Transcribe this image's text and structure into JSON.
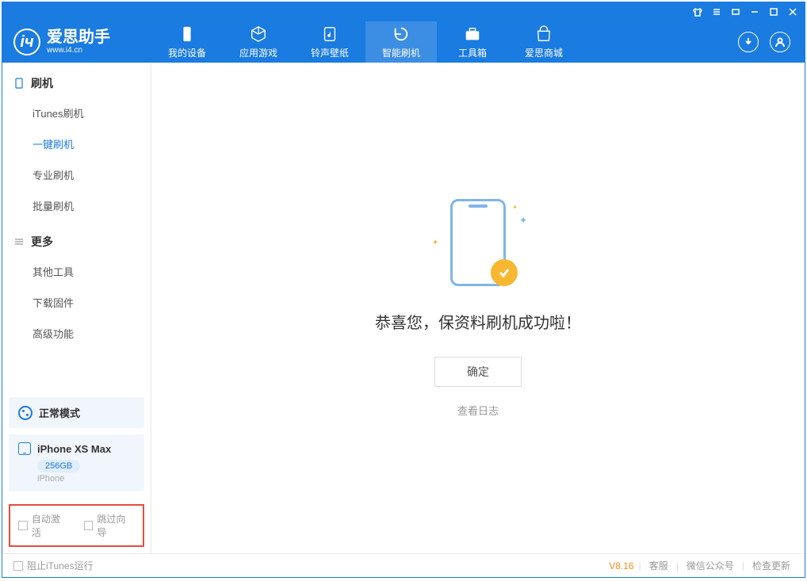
{
  "app": {
    "title": "爱思助手",
    "subtitle": "www.i4.cn"
  },
  "tabs": [
    {
      "label": "我的设备"
    },
    {
      "label": "应用游戏"
    },
    {
      "label": "铃声壁纸"
    },
    {
      "label": "智能刷机"
    },
    {
      "label": "工具箱"
    },
    {
      "label": "爱思商城"
    }
  ],
  "sidebar": {
    "group1_title": "刷机",
    "group1_items": [
      {
        "label": "iTunes刷机"
      },
      {
        "label": "一键刷机"
      },
      {
        "label": "专业刷机"
      },
      {
        "label": "批量刷机"
      }
    ],
    "group2_title": "更多",
    "group2_items": [
      {
        "label": "其他工具"
      },
      {
        "label": "下载固件"
      },
      {
        "label": "高级功能"
      }
    ]
  },
  "device": {
    "mode": "正常模式",
    "name": "iPhone XS Max",
    "capacity": "256GB",
    "type": "iPhone"
  },
  "checks": {
    "auto_activate": "自动激活",
    "skip_guide": "跳过向导"
  },
  "main": {
    "success_text": "恭喜您，保资料刷机成功啦！",
    "ok_label": "确定",
    "log_label": "查看日志"
  },
  "footer": {
    "block_itunes": "阻止iTunes运行",
    "version": "V8.16",
    "links": [
      {
        "label": "客服"
      },
      {
        "label": "微信公众号"
      },
      {
        "label": "检查更新"
      }
    ]
  }
}
